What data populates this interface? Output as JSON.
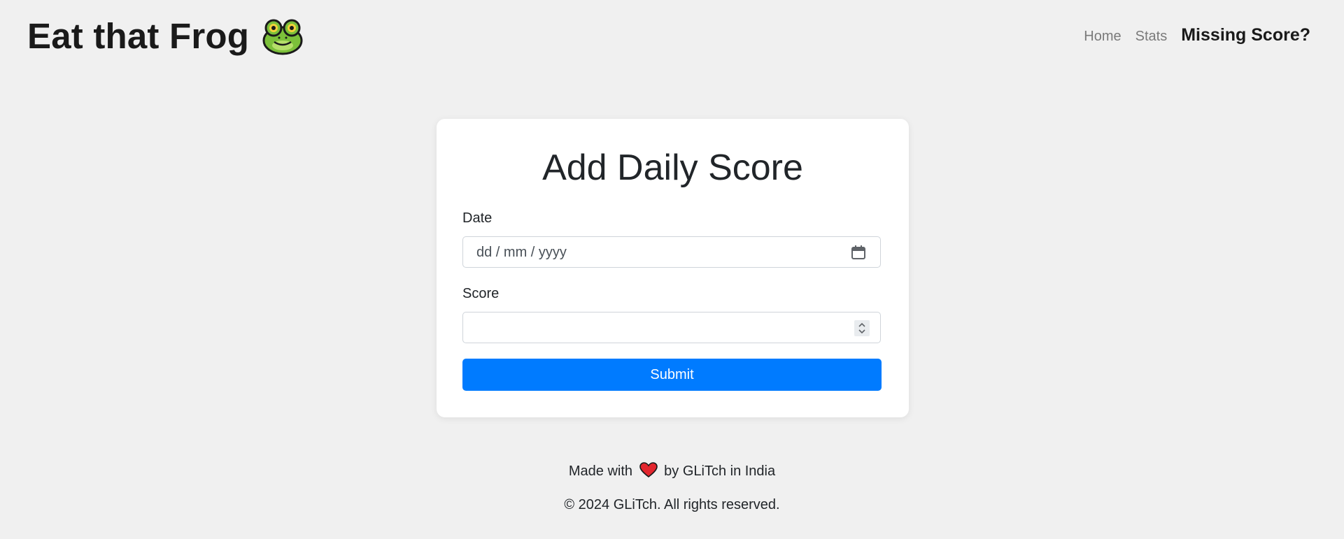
{
  "header": {
    "brand": "Eat that Frog",
    "brand_icon": "frog-emoji",
    "nav": [
      {
        "label": "Home",
        "active": false
      },
      {
        "label": "Stats",
        "active": false
      },
      {
        "label": "Missing Score?",
        "active": true
      }
    ]
  },
  "form": {
    "title": "Add Daily Score",
    "date_label": "Date",
    "date_placeholder": "dd / mm / yyyy",
    "date_icon": "calendar-icon",
    "score_label": "Score",
    "score_value": "",
    "score_icon": "number-spinner-icon",
    "submit_label": "Submit"
  },
  "footer": {
    "made_prefix": "Made with",
    "heart_icon": "heart-icon",
    "made_suffix": "by GLiTch in India",
    "copyright": "© 2024 GLiTch. All rights reserved."
  },
  "colors": {
    "background": "#f0f0f0",
    "accent": "#007bff",
    "card": "#ffffff"
  }
}
